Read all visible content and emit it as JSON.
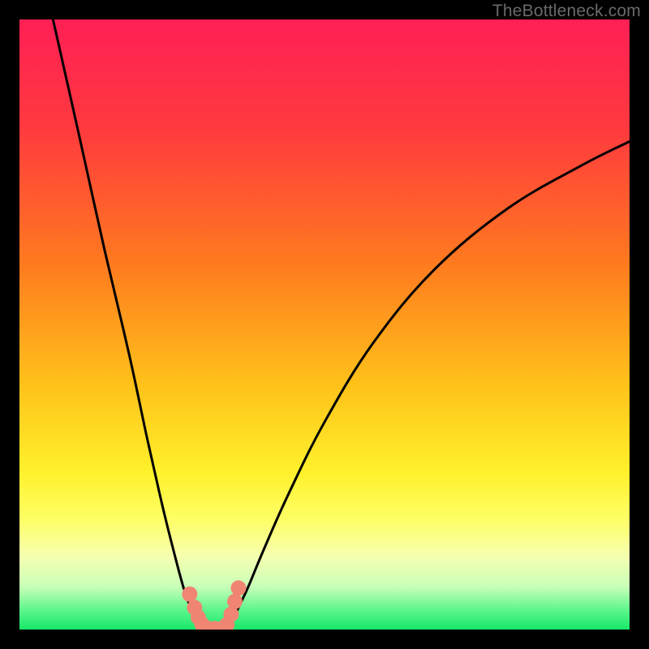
{
  "watermark": "TheBottleneck.com",
  "chart_data": {
    "type": "line",
    "title": "",
    "xlabel": "",
    "ylabel": "",
    "xlim": [
      0,
      100
    ],
    "ylim": [
      0,
      100
    ],
    "gradient_stops": [
      {
        "offset": 0,
        "color": "#ff1f55"
      },
      {
        "offset": 18,
        "color": "#ff3a3e"
      },
      {
        "offset": 40,
        "color": "#ff7a1f"
      },
      {
        "offset": 60,
        "color": "#ffc21a"
      },
      {
        "offset": 74,
        "color": "#fff02a"
      },
      {
        "offset": 82,
        "color": "#feff66"
      },
      {
        "offset": 88,
        "color": "#f6ffb0"
      },
      {
        "offset": 93,
        "color": "#c8ffb8"
      },
      {
        "offset": 97,
        "color": "#58f58a"
      },
      {
        "offset": 100,
        "color": "#17e86b"
      }
    ],
    "series": [
      {
        "name": "left-branch",
        "x": [
          5.5,
          10,
          14,
          18,
          21,
          23.5,
          25.5,
          27,
          28.3,
          29.2,
          29.9,
          30.4
        ],
        "y": [
          100,
          80,
          62,
          45,
          31,
          20,
          12,
          6.5,
          3.0,
          1.4,
          0.5,
          0.15
        ]
      },
      {
        "name": "right-branch",
        "x": [
          33.8,
          34.3,
          35,
          36,
          37.5,
          40,
          44,
          50,
          58,
          68,
          80,
          92,
          100
        ],
        "y": [
          0.15,
          0.6,
          1.6,
          3.8,
          7.0,
          13,
          22,
          34,
          47,
          59,
          69,
          76,
          80
        ]
      }
    ],
    "valley_markers": {
      "color": "#f08573",
      "points": [
        {
          "x": 27.9,
          "y": 5.8
        },
        {
          "x": 28.7,
          "y": 3.6
        },
        {
          "x": 29.3,
          "y": 2.0
        },
        {
          "x": 29.9,
          "y": 0.9
        },
        {
          "x": 31.0,
          "y": 0.15
        },
        {
          "x": 32.0,
          "y": 0.15
        },
        {
          "x": 33.1,
          "y": 0.15
        },
        {
          "x": 34.0,
          "y": 0.8
        },
        {
          "x": 34.7,
          "y": 2.5
        },
        {
          "x": 35.3,
          "y": 4.6
        },
        {
          "x": 35.9,
          "y": 6.8
        }
      ]
    }
  }
}
